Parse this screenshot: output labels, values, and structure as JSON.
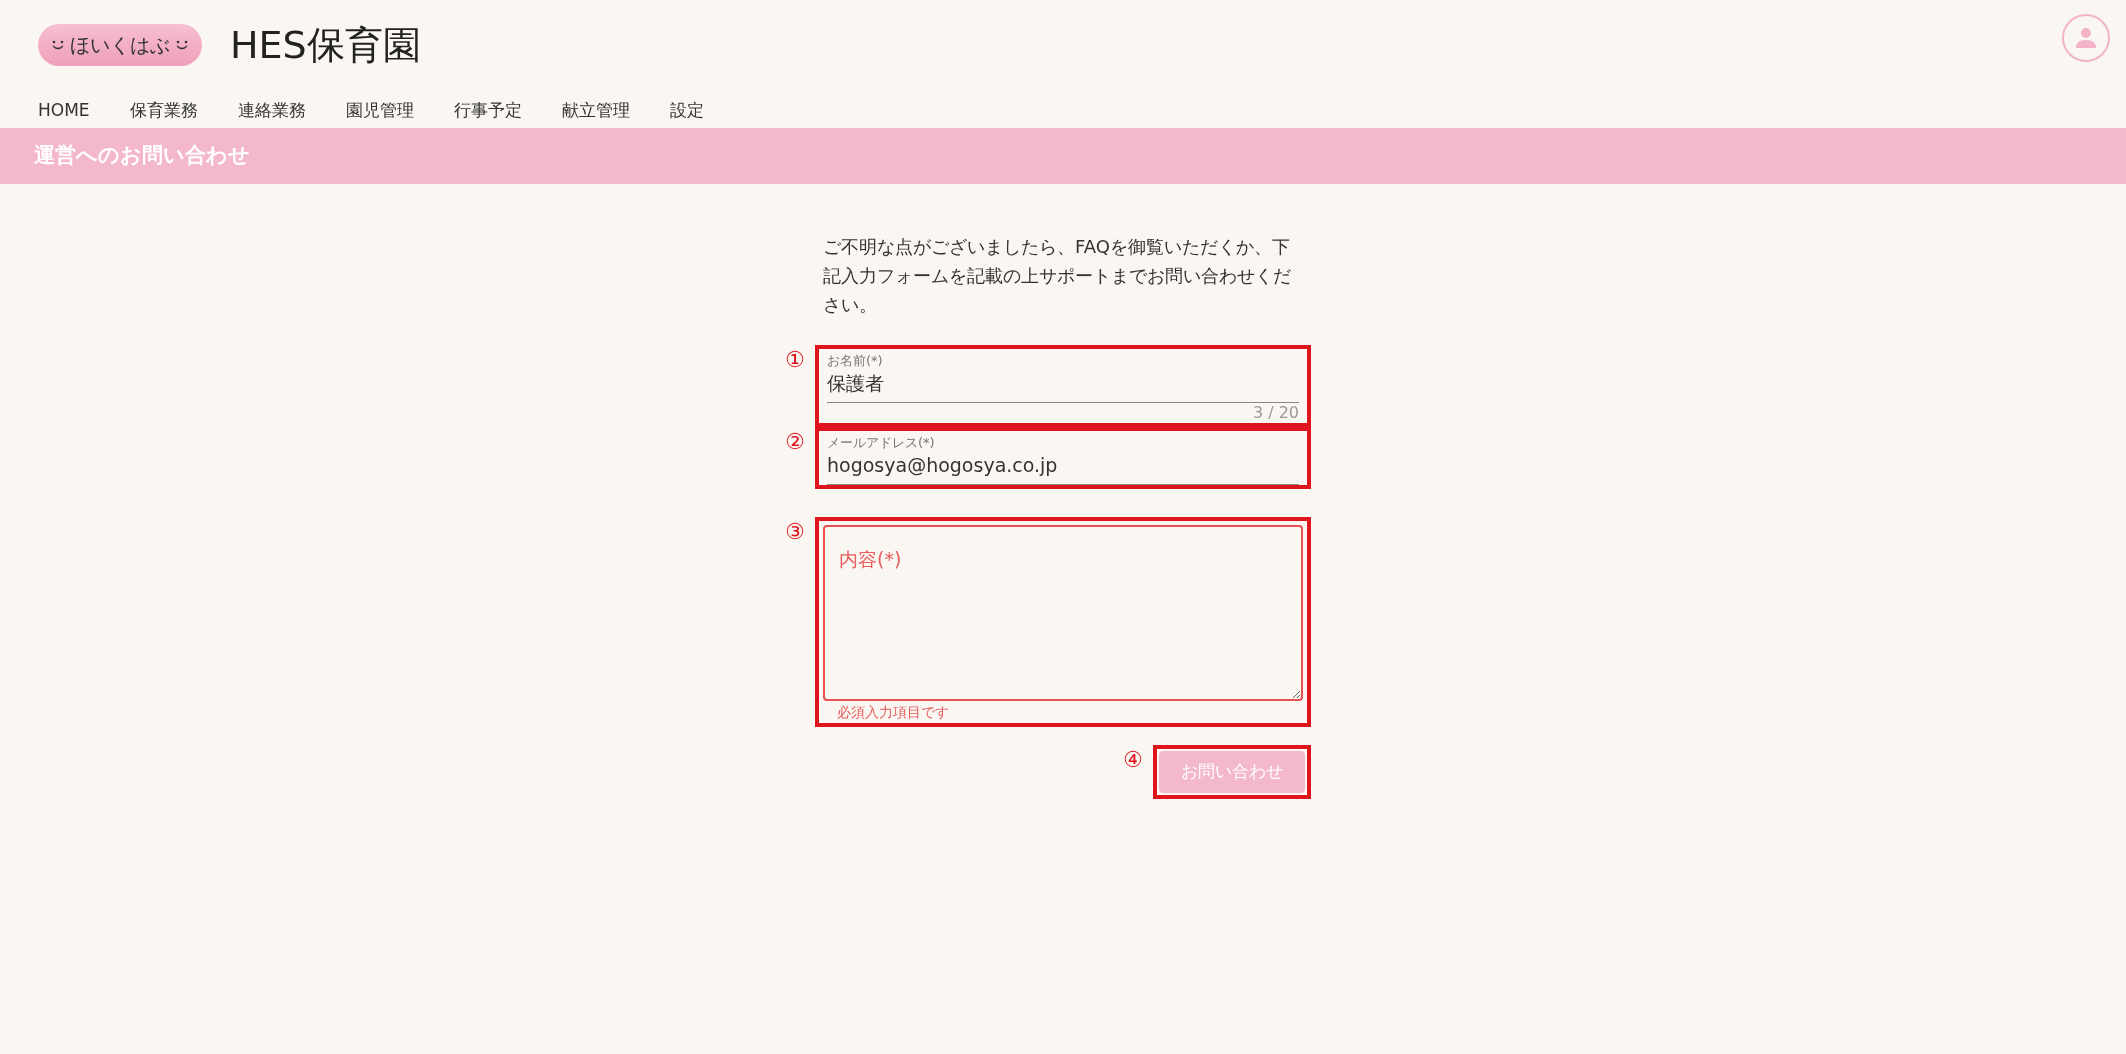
{
  "header": {
    "logo_text": "ほいくはぶ",
    "title": "HES保育園"
  },
  "nav": [
    {
      "label": "HOME"
    },
    {
      "label": "保育業務"
    },
    {
      "label": "連絡業務"
    },
    {
      "label": "園児管理"
    },
    {
      "label": "行事予定"
    },
    {
      "label": "献立管理"
    },
    {
      "label": "設定"
    }
  ],
  "page_title": "運営へのお問い合わせ",
  "intro": "ご不明な点がございましたら、FAQを御覧いただくか、下記入力フォームを記載の上サポートまでお問い合わせください。",
  "fields": [
    {
      "kind": "text",
      "marker": "①",
      "label": "お名前(*)",
      "value": "保護者",
      "counter": "3 / 20"
    },
    {
      "kind": "text",
      "marker": "②",
      "label": "メールアドレス(*)",
      "value": "hogosya@hogosya.co.jp"
    },
    {
      "kind": "textarea",
      "marker": "③",
      "placeholder": "内容(*)",
      "error": "必須入力項目です"
    }
  ],
  "submit": {
    "marker": "④",
    "label": "お問い合わせ",
    "disabled": true
  }
}
